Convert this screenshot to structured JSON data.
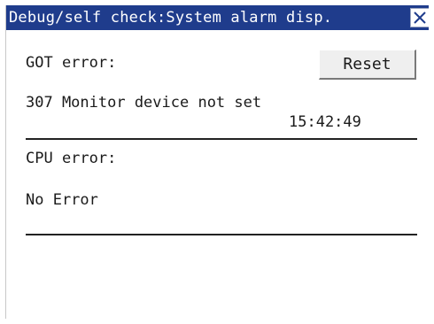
{
  "window": {
    "title": "Debug/self check:System alarm disp."
  },
  "got_section": {
    "label": "GOT error:",
    "reset_label": "Reset",
    "message": "307 Monitor device not set",
    "timestamp": "15:42:49"
  },
  "cpu_section": {
    "label": "CPU error:",
    "message": "No Error"
  },
  "colors": {
    "titlebar": "#1f3c8c",
    "background": "#ffffff"
  },
  "icons": {
    "close": "close-icon"
  }
}
